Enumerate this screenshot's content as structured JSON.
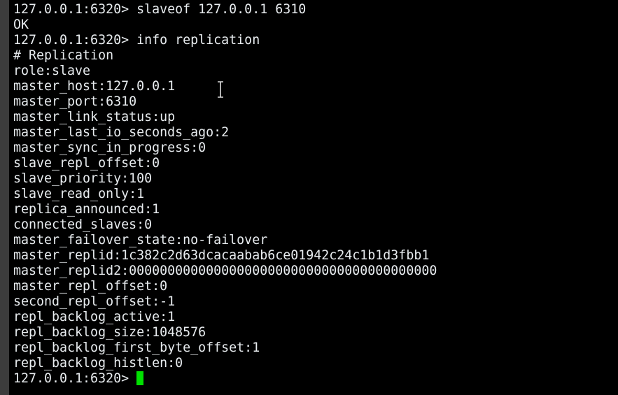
{
  "terminal": {
    "lines": [
      "127.0.0.1:6320> slaveof 127.0.0.1 6310",
      "OK",
      "127.0.0.1:6320> info replication",
      "# Replication",
      "role:slave",
      "master_host:127.0.0.1",
      "master_port:6310",
      "master_link_status:up",
      "master_last_io_seconds_ago:2",
      "master_sync_in_progress:0",
      "slave_repl_offset:0",
      "slave_priority:100",
      "slave_read_only:1",
      "replica_announced:1",
      "connected_slaves:0",
      "master_failover_state:no-failover",
      "master_replid:1c382c2d63dcacaabab6ce01942c24c1b1d3fbb1",
      "master_replid2:0000000000000000000000000000000000000000",
      "master_repl_offset:0",
      "second_repl_offset:-1",
      "repl_backlog_active:1",
      "repl_backlog_size:1048576",
      "repl_backlog_first_byte_offset:1",
      "repl_backlog_histlen:0"
    ],
    "prompt": "127.0.0.1:6320> ",
    "cursor_color": "#00e000"
  }
}
